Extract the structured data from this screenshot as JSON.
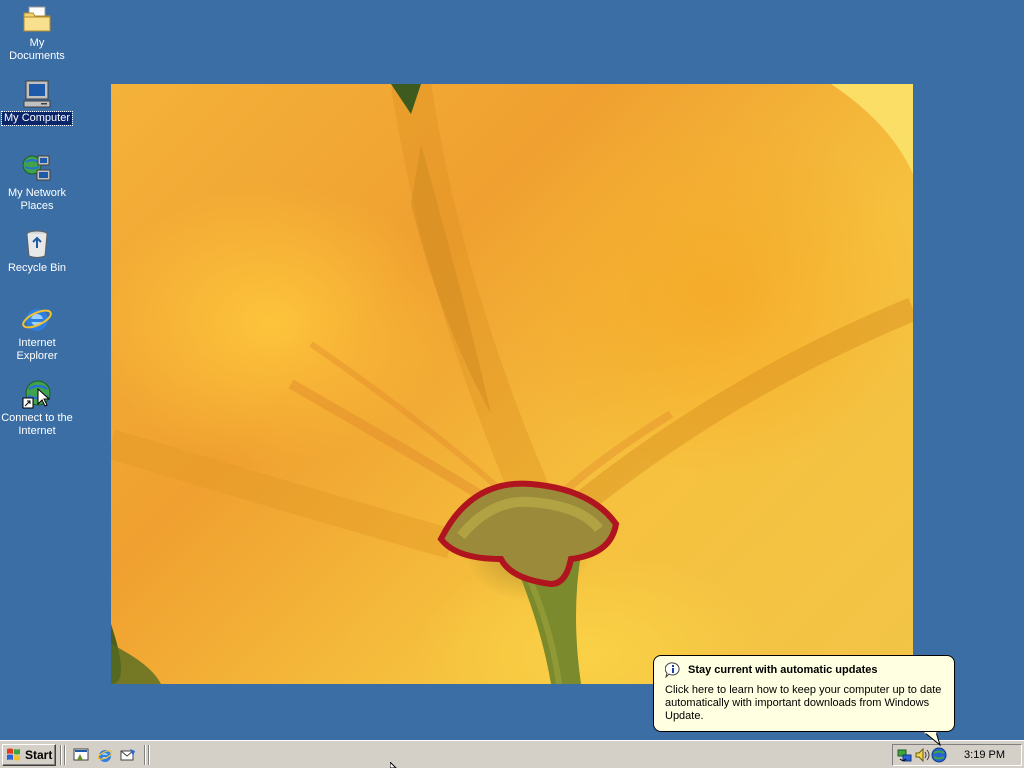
{
  "desktop": {
    "icons": [
      {
        "label": "My Documents",
        "icon": "folder-documents-icon"
      },
      {
        "label": "My Computer",
        "icon": "computer-icon",
        "selected": true
      },
      {
        "label": "My Network Places",
        "icon": "network-places-icon"
      },
      {
        "label": "Recycle Bin",
        "icon": "recycle-bin-icon"
      },
      {
        "label": "Internet Explorer",
        "icon": "internet-explorer-icon"
      },
      {
        "label": "Connect to the Internet",
        "icon": "connect-internet-icon"
      }
    ],
    "background_color": "#3a6ea5",
    "selection_color": "#0a246a"
  },
  "taskbar": {
    "start_label": "Start",
    "quick_launch": [
      "show-desktop-icon",
      "internet-explorer-icon",
      "outlook-express-icon"
    ],
    "tray_icons": [
      "network-connection-icon",
      "volume-icon",
      "windows-update-icon"
    ],
    "clock": "3:19 PM"
  },
  "balloon": {
    "title": "Stay current with automatic updates",
    "body": "Click here to learn how to keep your computer up to date automatically with important downloads from Windows Update.",
    "icon": "info-icon",
    "background_color": "#ffffe1"
  }
}
